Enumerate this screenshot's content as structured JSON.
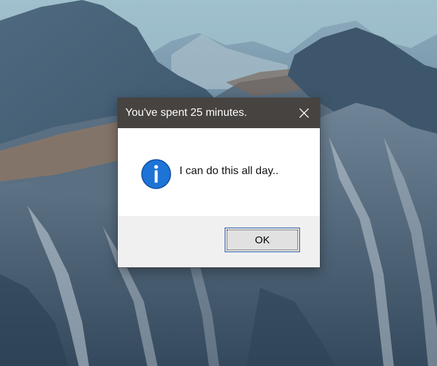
{
  "dialog": {
    "title": "You've spent 25 minutes.",
    "message": "I can do this all day..",
    "ok_label": "OK",
    "icon": "info-icon",
    "close_icon": "close-icon"
  },
  "colors": {
    "titlebar": "#464340",
    "info_blue": "#1d73d6",
    "button_focus": "#2b5fb4",
    "footer": "#f0f0f0"
  }
}
